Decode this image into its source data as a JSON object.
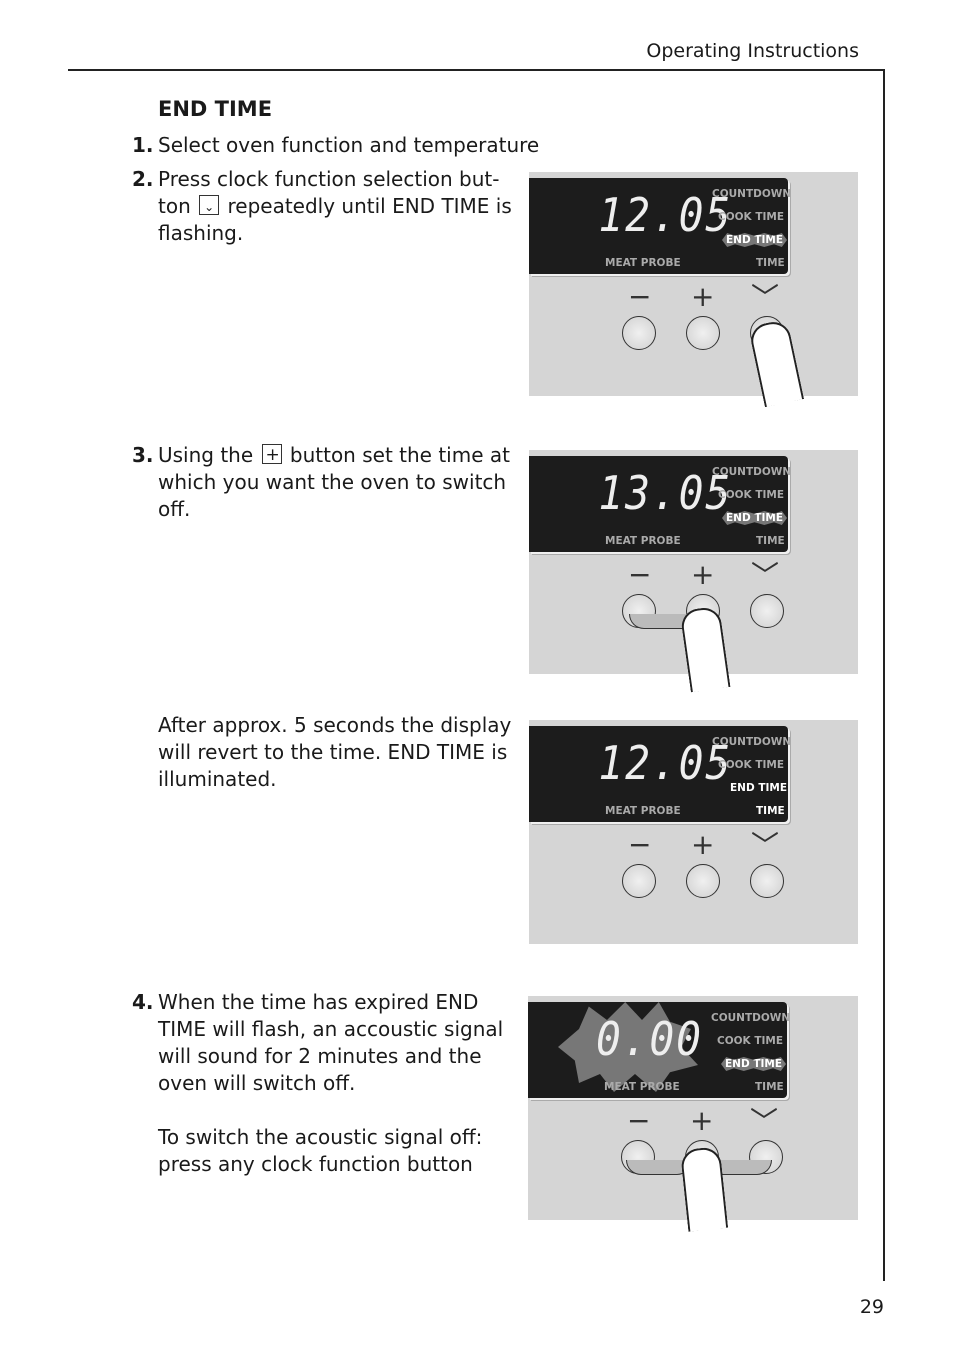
{
  "header": {
    "title": "Operating Instructions",
    "page_number": "29"
  },
  "section": {
    "heading": "END TIME"
  },
  "steps": [
    {
      "num": "1.",
      "text": "Select oven function and temperature"
    },
    {
      "num": "2.",
      "text_before": "Press clock function selection but- ton",
      "icon": "chevron-down-key",
      "text_after": "repeatedly until END TIME is flashing."
    },
    {
      "num": "3.",
      "text_before": "Using the",
      "icon": "plus-key",
      "text_after": "button set the time at which you want the oven to switch off."
    },
    {
      "num": "",
      "text": "After approx. 5 seconds the display will revert to the time. END TIME is illuminated."
    },
    {
      "num": "4.",
      "text": "When the time has expired END TIME will flash, an accoustic signal will sound for 2 minutes and the oven will switch off.",
      "text2": "To switch the acoustic signal off: press any clock function button"
    }
  ],
  "panels": [
    {
      "display": "12.05",
      "state": "END TIME flashing, pressing select button"
    },
    {
      "display": "13.05",
      "state": "END TIME flashing, pressing plus button"
    },
    {
      "display": "12.05",
      "state": "END TIME and TIME illuminated"
    },
    {
      "display": "0.00",
      "state": "display and END TIME flashing, pressing any button"
    }
  ],
  "labels": {
    "countdown": "COUNTDOWN",
    "cook_time": "COOK TIME",
    "end_time": "END TIME",
    "time": "TIME",
    "meat_probe": "MEAT PROBE"
  },
  "buttons": {
    "minus": "−",
    "plus": "+",
    "select": "﹀"
  }
}
